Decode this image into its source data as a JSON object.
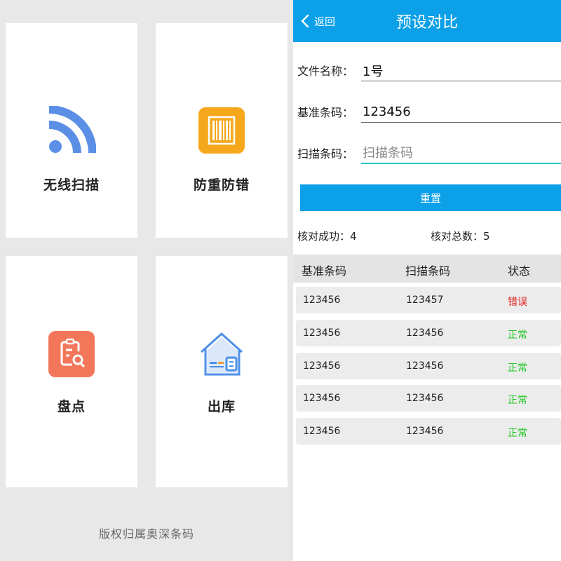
{
  "left": {
    "tiles": [
      {
        "label": "无线扫描",
        "icon": "wireless-signal-icon",
        "color": "#5b8fe6"
      },
      {
        "label": "防重防错",
        "icon": "barcode-icon",
        "color": "#f6a81c"
      },
      {
        "label": "盘点",
        "icon": "inventory-document-search-icon",
        "color": "#f2775a"
      },
      {
        "label": "出库",
        "icon": "warehouse-house-icon",
        "color": "#4d8fe8"
      }
    ],
    "copyright": "版权归属奥深条码"
  },
  "right": {
    "header": {
      "back_label": "返回",
      "title": "预设对比",
      "color": "#0ba0e8"
    },
    "form": {
      "file_name_label": "文件名称：",
      "file_name_value": "1号",
      "base_code_label": "基准条码：",
      "base_code_value": "123456",
      "scan_code_label": "扫描条码：",
      "scan_code_placeholder": "扫描条码"
    },
    "reset_label": "重置",
    "stats": {
      "success_label": "核对成功：",
      "success_value": "4",
      "total_label": "核对总数：",
      "total_value": "5"
    },
    "table": {
      "headers": [
        "基准条码",
        "扫描条码",
        "状态"
      ],
      "rows": [
        {
          "base": "123456",
          "scan": "123457",
          "status": "错误",
          "state": "error"
        },
        {
          "base": "123456",
          "scan": "123456",
          "status": "正常",
          "state": "ok"
        },
        {
          "base": "123456",
          "scan": "123456",
          "status": "正常",
          "state": "ok"
        },
        {
          "base": "123456",
          "scan": "123456",
          "status": "正常",
          "state": "ok"
        },
        {
          "base": "123456",
          "scan": "123456",
          "status": "正常",
          "state": "ok"
        }
      ],
      "error_color": "#e02020",
      "ok_color": "#1ec61e"
    }
  }
}
